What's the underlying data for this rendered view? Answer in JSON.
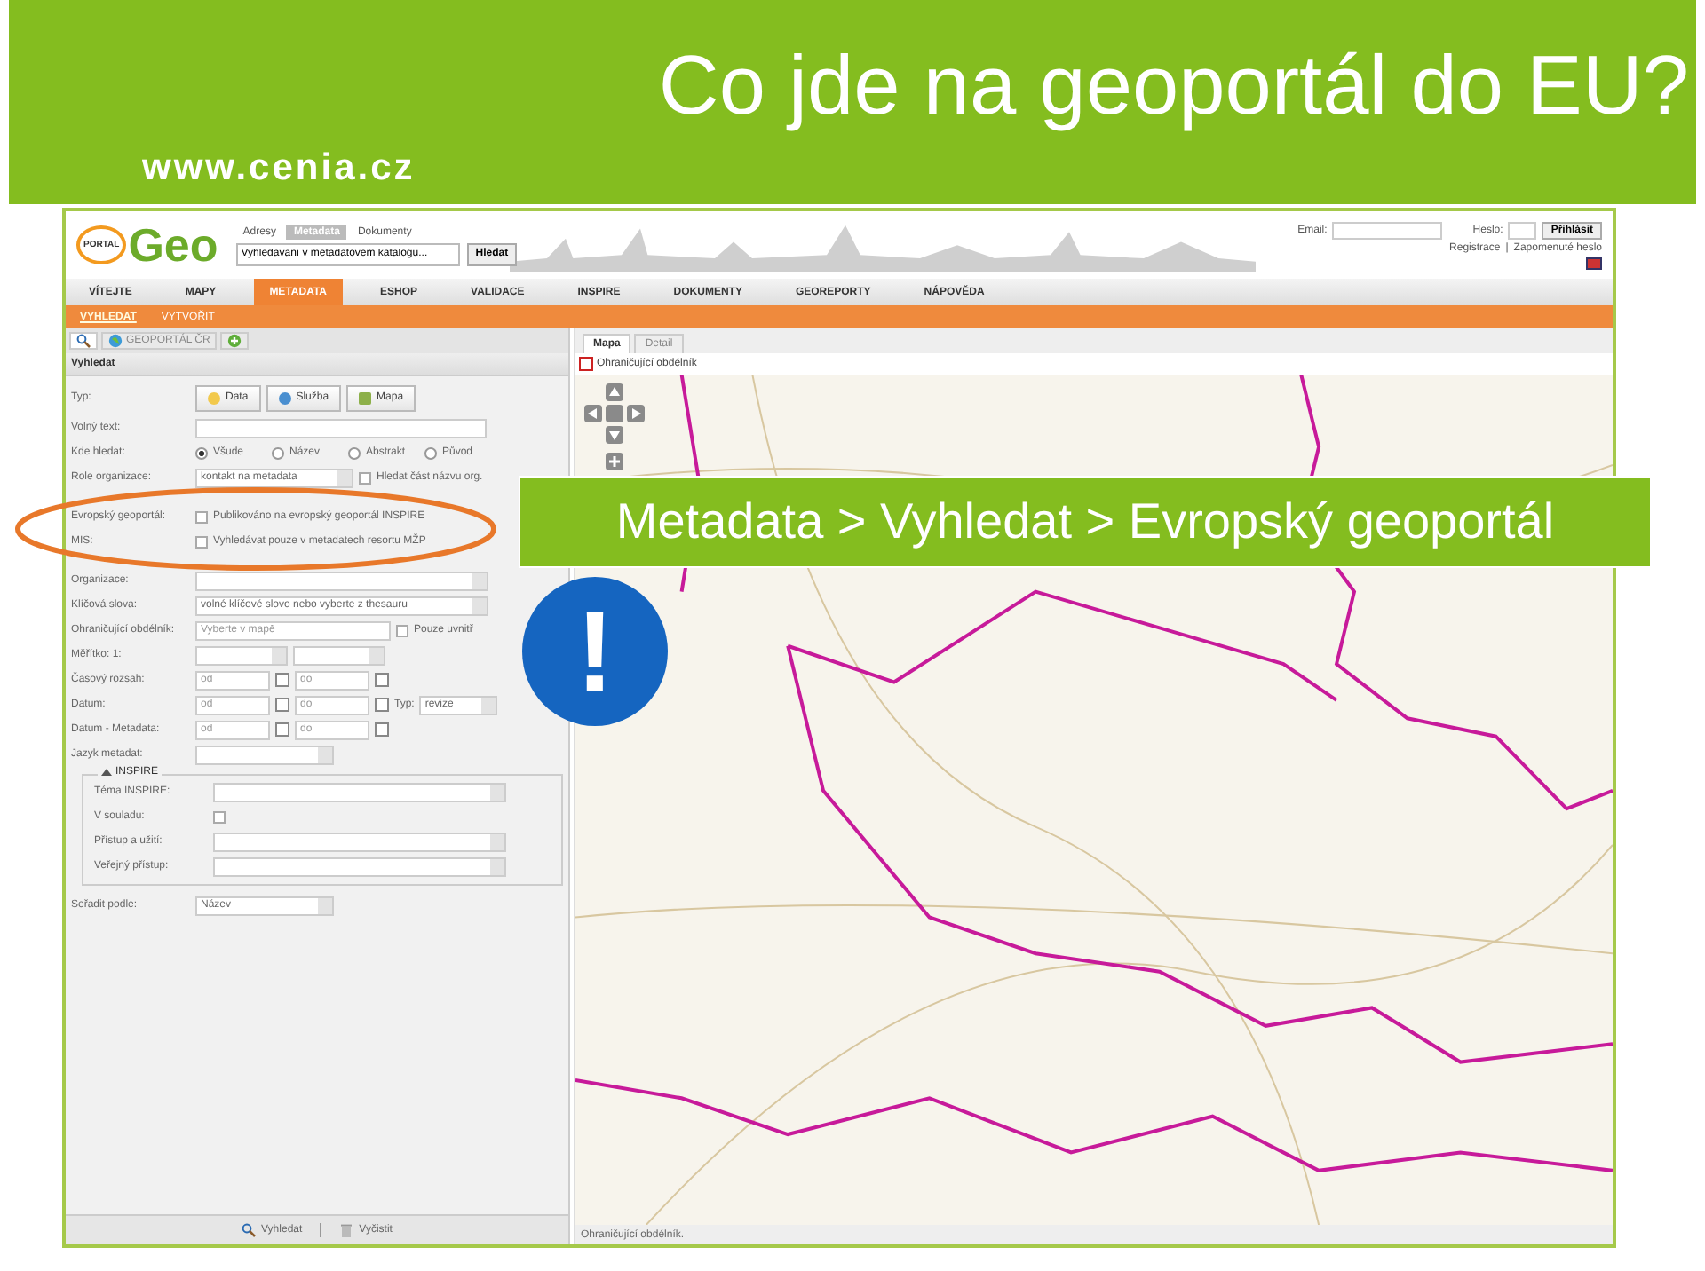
{
  "slide": {
    "title": "Co jde na geoportál do EU?",
    "site_url": "www.cenia.cz"
  },
  "portal": {
    "logo": {
      "small": "PORTAL",
      "main": "Geo"
    },
    "top_tabs": [
      {
        "label": "Adresy",
        "selected": false
      },
      {
        "label": "Metadata",
        "selected": true
      },
      {
        "label": "Dokumenty",
        "selected": false
      }
    ],
    "search": {
      "value": "Vyhledávání v metadatovém katalogu...",
      "button": "Hledat"
    },
    "login": {
      "email_label": "Email:",
      "password_label": "Heslo:",
      "button": "Přihlásit",
      "links": [
        "Registrace",
        "Zapomenuté heslo"
      ],
      "separator": "|"
    },
    "nav": [
      {
        "label": "VÍTEJTE",
        "selected": false
      },
      {
        "label": "MAPY",
        "selected": false
      },
      {
        "label": "METADATA",
        "selected": true
      },
      {
        "label": "ESHOP",
        "selected": false
      },
      {
        "label": "VALIDACE",
        "selected": false
      },
      {
        "label": "INSPIRE",
        "selected": false
      },
      {
        "label": "DOKUMENTY",
        "selected": false
      },
      {
        "label": "GEOREPORTY",
        "selected": false
      },
      {
        "label": "NÁPOVĚDA",
        "selected": false
      }
    ],
    "subnav": [
      {
        "label": "VYHLEDAT",
        "selected": true
      },
      {
        "label": "VYTVOŘIT",
        "selected": false
      }
    ],
    "left_tabs": [
      {
        "kind": "search",
        "selected": true
      },
      {
        "kind": "globe",
        "label": "GEOPORTÁL ČR",
        "selected": false
      },
      {
        "kind": "add",
        "selected": false
      }
    ],
    "panel_title": "Vyhledat",
    "rows": [
      {
        "kind": "type-buttons",
        "label": "Typ:",
        "buttons": [
          "Data",
          "Služba",
          "Mapa"
        ]
      },
      {
        "kind": "text",
        "label": "Volný text:"
      },
      {
        "kind": "radio",
        "label": "Kde hledat:",
        "options": [
          {
            "label": "Všude",
            "selected": true
          },
          {
            "label": "Název",
            "selected": false
          },
          {
            "label": "Abstrakt",
            "selected": false
          },
          {
            "label": "Původ",
            "selected": false
          }
        ]
      },
      {
        "kind": "select-check",
        "label": "Role organizace:",
        "value": "kontakt na metadata",
        "check": {
          "label": "Hledat část názvu org.",
          "checked": false
        }
      },
      {
        "kind": "check",
        "label": "Evropský geoportál:",
        "highlighted": true,
        "check": {
          "label": "Publikováno na evropský geoportál INSPIRE",
          "checked": false
        }
      },
      {
        "kind": "check",
        "label": "MIS:",
        "highlighted": true,
        "check": {
          "label": "Vyhledávat pouze v metadatech resortu MŽP",
          "checked": false
        }
      },
      {
        "kind": "select",
        "label": "Organizace:"
      },
      {
        "kind": "select",
        "label": "Klíčová slova:",
        "value": "volné klíčové slovo nebo vyberte z thesauru"
      },
      {
        "kind": "text-check",
        "label": "Ohraničující obdélník:",
        "placeholder": "Vyberte v mapě",
        "check": {
          "label": "Pouze uvnitř",
          "checked": false
        }
      },
      {
        "kind": "two-selects",
        "label": "Měřítko: 1:"
      },
      {
        "kind": "dates",
        "label": "Časový rozsah:",
        "from": "od",
        "to": "do"
      },
      {
        "kind": "dates",
        "label": "Datum:",
        "from": "od",
        "to": "do",
        "type_label": "Typ:",
        "type_value": "revize"
      },
      {
        "kind": "dates",
        "label": "Datum - Metadata:",
        "from": "od",
        "to": "do"
      },
      {
        "kind": "small-select",
        "label": "Jazyk metadat:"
      }
    ],
    "inspire": {
      "legend": "INSPIRE",
      "expanded": true,
      "rows": [
        {
          "kind": "select",
          "label": "Téma INSPIRE:"
        },
        {
          "kind": "checkbox",
          "label": "V souladu:",
          "checked": false
        },
        {
          "kind": "select",
          "label": "Přístup a užití:"
        },
        {
          "kind": "select",
          "label": "Veřejný přístup:"
        }
      ]
    },
    "sort": {
      "label": "Seřadit podle:",
      "value": "Název"
    },
    "actions": [
      {
        "kind": "search",
        "label": "Vyhledat"
      },
      {
        "kind": "clear",
        "label": "Vyčistit"
      }
    ],
    "map_tabs": [
      {
        "label": "Mapa",
        "selected": true
      },
      {
        "label": "Detail",
        "selected": false
      }
    ],
    "map_tool": "Ohraničující obdélník",
    "map_status": "Ohraničující obdélník."
  },
  "overlay": {
    "callout": "Metadata > Vyhledat > Evropský geoportál",
    "alert_mark": "!"
  }
}
